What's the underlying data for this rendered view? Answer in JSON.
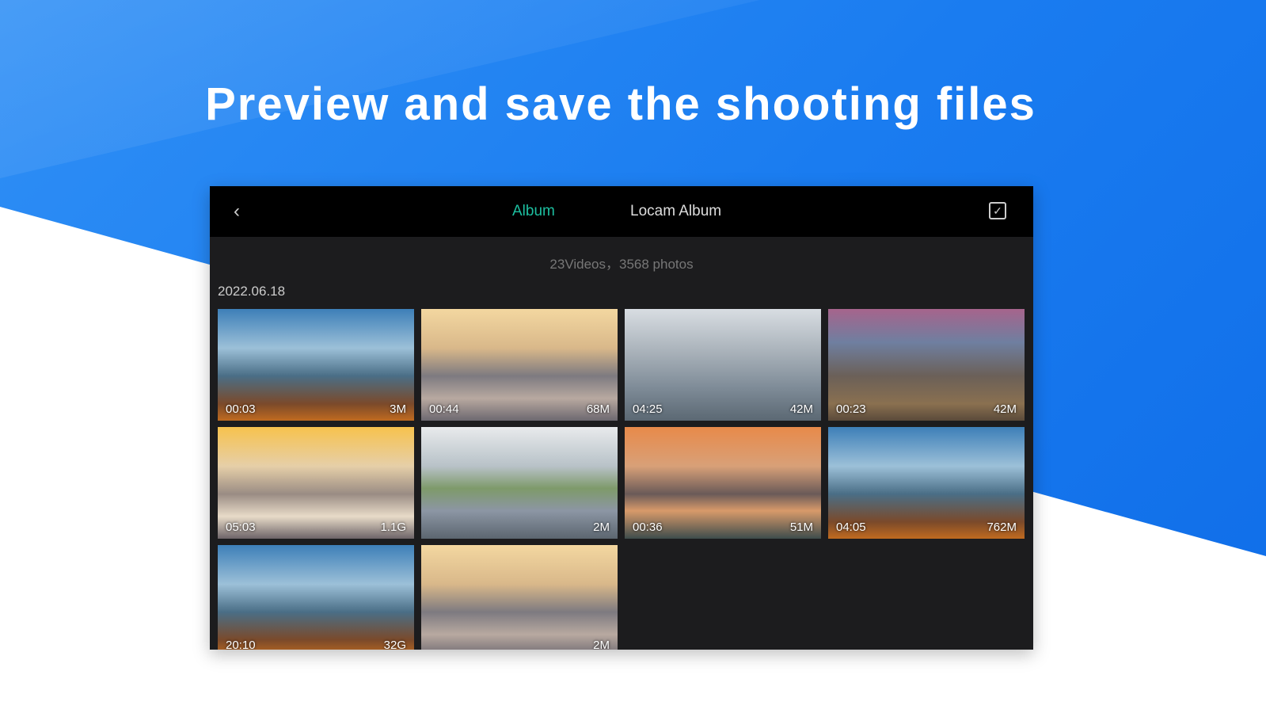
{
  "headline": "Preview and save the shooting files",
  "topbar": {
    "tabs": [
      "Album",
      "Locam Album"
    ],
    "back_icon": "chevron-left-icon",
    "select_icon": "checkbox-icon"
  },
  "summary": "23Videos，3568 photos",
  "date": "2022.06.18",
  "accent": "#1dbfa0",
  "items": [
    {
      "duration": "00:03",
      "size": "3M"
    },
    {
      "duration": "00:44",
      "size": "68M"
    },
    {
      "duration": "04:25",
      "size": "42M"
    },
    {
      "duration": "00:23",
      "size": "42M"
    },
    {
      "duration": "05:03",
      "size": "1.1G"
    },
    {
      "duration": "",
      "size": "2M"
    },
    {
      "duration": "00:36",
      "size": "51M"
    },
    {
      "duration": "04:05",
      "size": "762M"
    },
    {
      "duration": "20:10",
      "size": "32G"
    },
    {
      "duration": "",
      "size": "2M"
    }
  ]
}
